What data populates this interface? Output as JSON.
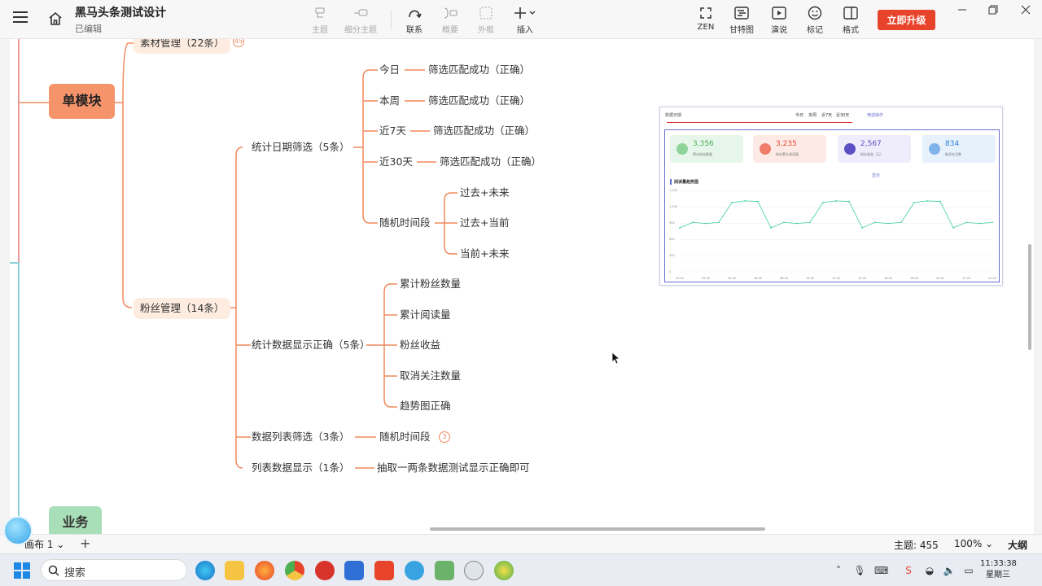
{
  "app": {
    "title": "黑马头条测试设计",
    "status": "已编辑",
    "upgrade_label": "立即升级"
  },
  "toolbar": {
    "topic": "主题",
    "subtopic": "细分主题",
    "relation": "联系",
    "summary": "概要",
    "boundary": "外框",
    "insert": "插入",
    "zen": "ZEN",
    "gantt": "甘特图",
    "present": "演说",
    "marker": "标记",
    "format": "格式"
  },
  "mindmap": {
    "single_module": "单模块",
    "business": "业务",
    "material_mgmt": "素材管理（22条）",
    "material_badge": "45",
    "fans_mgmt": "粉丝管理（14条）",
    "date_filter": "统计日期筛选（5条）",
    "today": "今日",
    "week": "本周",
    "last7": "近7天",
    "last30": "近30天",
    "random_period": "随机时间段",
    "filter_ok": "筛选匹配成功（正确）",
    "past_future": "过去+未来",
    "past_now": "过去+当前",
    "now_future": "当前+未来",
    "stats_display": "统计数据显示正确（5条）",
    "fans_total": "累计粉丝数量",
    "reads_total": "累计阅读量",
    "fans_income": "粉丝收益",
    "unfollow_count": "取消关注数量",
    "trend_ok": "趋势图正确",
    "list_filter": "数据列表筛选（3条）",
    "list_random": "随机时间段",
    "list_badge": "3",
    "list_display": "列表数据显示（1条）",
    "sample_check": "抽取一两条数据测试显示正确即可"
  },
  "preview": {
    "date_label": "数据日期",
    "tabs": [
      "今日",
      "本周",
      "近7天",
      "近30天"
    ],
    "filter_action": "筛选操作",
    "show_label": "显示",
    "chart_title": "阅读量趋势图",
    "stats": [
      {
        "value": "3,356",
        "label": "累计粉丝数量",
        "color": "#4caf50"
      },
      {
        "value": "3,235",
        "label": "粉丝累计阅读量",
        "color": "#e8442c"
      },
      {
        "value": "2,567",
        "label": "粉丝收益（元）",
        "color": "#5b4fc4"
      },
      {
        "value": "834",
        "label": "取消关注数",
        "color": "#2f7fd6"
      }
    ]
  },
  "chart_data": {
    "type": "line",
    "title": "阅读量趋势图",
    "x": [
      "00:00",
      "02:00",
      "04:00",
      "06:00",
      "08:00",
      "10:00",
      "12:00",
      "14:00",
      "16:00",
      "18:00",
      "20:00",
      "22:00",
      "24:00"
    ],
    "y_ticks": [
      "1,500",
      "1,200",
      "900",
      "600",
      "300",
      "0"
    ],
    "ylim": [
      0,
      1500
    ],
    "series": [
      {
        "values": [
          820,
          920,
          900,
          920,
          1290,
          1320,
          1310,
          820,
          920,
          900,
          920,
          1290,
          1320,
          1310,
          820,
          920,
          900,
          920,
          1290,
          1320,
          1310,
          820,
          920,
          900,
          920
        ]
      }
    ],
    "color": "#3fcf9a"
  },
  "bottom": {
    "sheet": "画布 1",
    "topics": "主题: 455",
    "zoom": "100%",
    "outline": "大纲"
  },
  "taskbar": {
    "search_placeholder": "搜索",
    "time": "11:33:38",
    "weekday": "星期三"
  }
}
